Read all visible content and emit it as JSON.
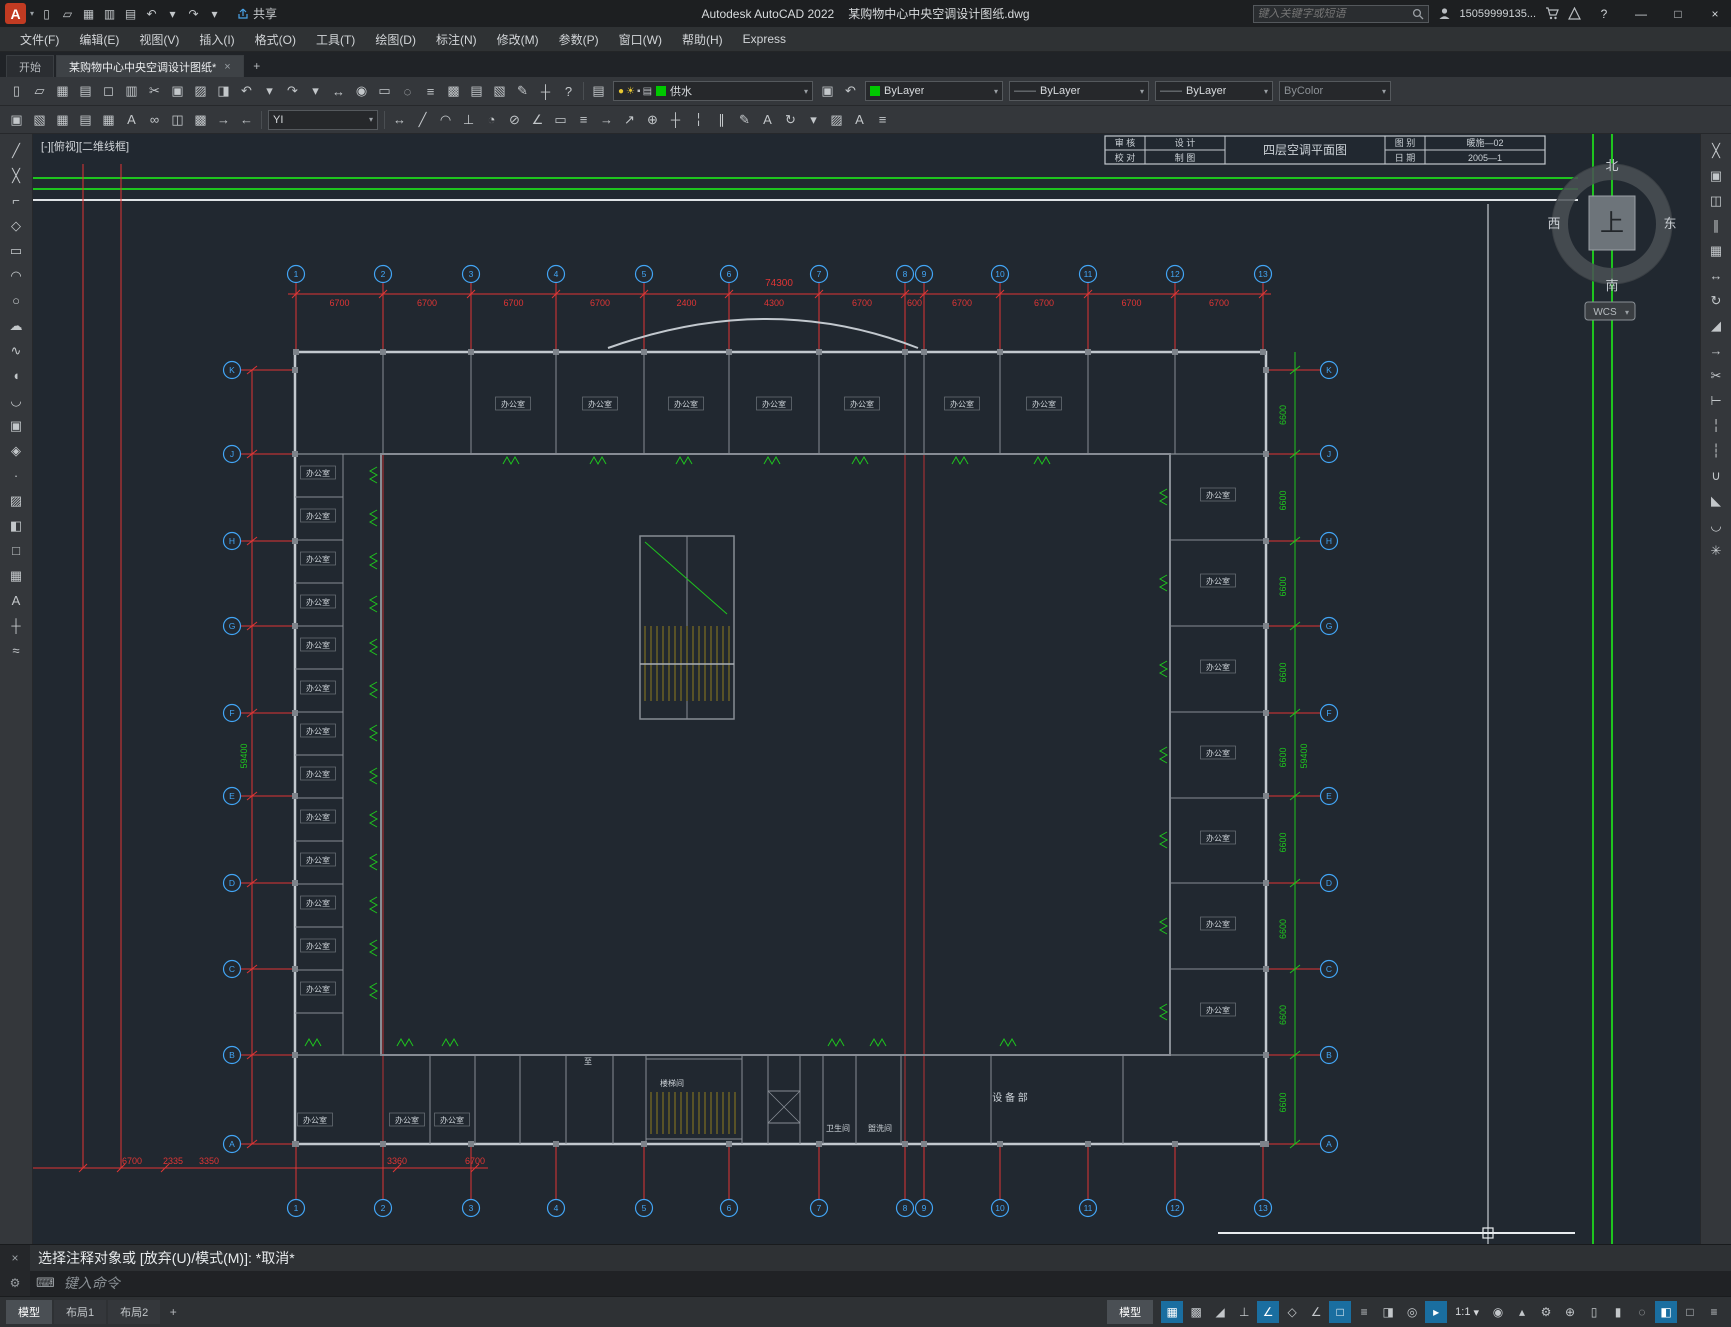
{
  "title_bar": {
    "app_title": "Autodesk AutoCAD 2022",
    "doc_title": "某购物中心中央空调设计图纸.dwg",
    "share_label": "共享",
    "search_placeholder": "键入关键字或短语",
    "user_id": "15059999135...",
    "help_glyph": "?",
    "window": {
      "minimize": "—",
      "maximize": "□",
      "close": "×"
    },
    "qat_icons": [
      {
        "name": "new-file-icon",
        "glyph": "▯"
      },
      {
        "name": "open-file-icon",
        "glyph": "▱"
      },
      {
        "name": "save-icon",
        "glyph": "▦"
      },
      {
        "name": "save-as-icon",
        "glyph": "▥"
      },
      {
        "name": "plot-icon",
        "glyph": "▤"
      },
      {
        "name": "undo-icon",
        "glyph": "↶"
      },
      {
        "name": "undo-list-icon",
        "glyph": "▾"
      },
      {
        "name": "redo-icon",
        "glyph": "↷"
      },
      {
        "name": "redo-list-icon",
        "glyph": "▾"
      }
    ]
  },
  "menu_bar": {
    "items": [
      "文件(F)",
      "编辑(E)",
      "视图(V)",
      "插入(I)",
      "格式(O)",
      "工具(T)",
      "绘图(D)",
      "标注(N)",
      "修改(M)",
      "参数(P)",
      "窗口(W)",
      "帮助(H)",
      "Express"
    ]
  },
  "tab_bar": {
    "start_tab": "开始",
    "doc_tab": "某购物中心中央空调设计图纸*",
    "close_glyph": "×",
    "new_tab_glyph": "+"
  },
  "toolbar1": {
    "icons": [
      {
        "name": "new-file-icon",
        "glyph": "▯"
      },
      {
        "name": "open-file-icon",
        "glyph": "▱"
      },
      {
        "name": "save-icon",
        "glyph": "▦"
      },
      {
        "name": "plot-icon",
        "glyph": "▤"
      },
      {
        "name": "plot-preview-icon",
        "glyph": "◻"
      },
      {
        "name": "publish-icon",
        "glyph": "▥"
      },
      {
        "name": "cut-icon",
        "glyph": "✂"
      },
      {
        "name": "copy-clip-icon",
        "glyph": "▣"
      },
      {
        "name": "paste-icon",
        "glyph": "▨"
      },
      {
        "name": "match-properties-icon",
        "glyph": "◨"
      },
      {
        "name": "undo-icon",
        "glyph": "↶"
      },
      {
        "name": "undo-list-icon",
        "glyph": "▾"
      },
      {
        "name": "redo-icon",
        "glyph": "↷"
      },
      {
        "name": "redo-list-icon",
        "glyph": "▾"
      },
      {
        "name": "pan-icon",
        "glyph": "↔"
      },
      {
        "name": "zoom-realtime-icon",
        "glyph": "◉"
      },
      {
        "name": "zoom-window-icon",
        "glyph": "▭"
      },
      {
        "name": "zoom-previous-icon",
        "glyph": "◌"
      },
      {
        "name": "properties-palette-icon",
        "glyph": "≡"
      },
      {
        "name": "designcenter-icon",
        "glyph": "▩"
      },
      {
        "name": "tool-palettes-icon",
        "glyph": "▤"
      },
      {
        "name": "sheet-set-manager-icon",
        "glyph": "▧"
      },
      {
        "name": "markup-icon",
        "glyph": "✎"
      },
      {
        "name": "quickcalc-icon",
        "glyph": "┼"
      },
      {
        "name": "help-icon",
        "glyph": "?"
      }
    ],
    "layer_properties_icon": "▤",
    "layer_states": [
      {
        "name": "layer-on-icon",
        "glyph": "●",
        "color": "#e8c832"
      },
      {
        "name": "layer-freeze-icon",
        "glyph": "☀",
        "color": "#e8c832"
      },
      {
        "name": "layer-lock-icon",
        "glyph": "▪",
        "color": "#b9bdc1"
      },
      {
        "name": "layer-plot-icon",
        "glyph": "▤",
        "color": "#b9bdc1"
      }
    ],
    "layer_color": "#00c800",
    "layer_value": "供水",
    "make_current_icon": "▣",
    "layer_previous_icon": "↶",
    "color_swatch": "#00c800",
    "color_value": "ByLayer",
    "linetype_value": "ByLayer",
    "lineweight_value": "ByLayer",
    "plotstyle_value": "ByColor"
  },
  "toolbar2": {
    "icons_left": [
      {
        "name": "insert-block-icon",
        "glyph": "▣"
      },
      {
        "name": "attach-xref-icon",
        "glyph": "▧"
      },
      {
        "name": "attach-image-icon",
        "glyph": "▦"
      },
      {
        "name": "field-icon",
        "glyph": "▤"
      },
      {
        "name": "table-icon",
        "glyph": "▦"
      },
      {
        "name": "mtext-icon",
        "glyph": "A"
      },
      {
        "name": "hyperlink-icon",
        "glyph": "∞"
      },
      {
        "name": "ole-object-icon",
        "glyph": "◫"
      },
      {
        "name": "raster-icon",
        "glyph": "▩"
      },
      {
        "name": "import-icon",
        "glyph": "→"
      },
      {
        "name": "export-icon",
        "glyph": "←"
      }
    ],
    "text_style_value": "YI",
    "icons_right": [
      {
        "name": "linear-dimension-icon",
        "glyph": "↔"
      },
      {
        "name": "aligned-dimension-icon",
        "glyph": "╱"
      },
      {
        "name": "arc-length-icon",
        "glyph": "◠"
      },
      {
        "name": "ordinate-icon",
        "glyph": "⊥"
      },
      {
        "name": "radius-dimension-icon",
        "glyph": "◔"
      },
      {
        "name": "diameter-dimension-icon",
        "glyph": "⊘"
      },
      {
        "name": "angular-dimension-icon",
        "glyph": "∠"
      },
      {
        "name": "quick-dimension-icon",
        "glyph": "▭"
      },
      {
        "name": "baseline-dimension-icon",
        "glyph": "≡"
      },
      {
        "name": "continue-dimension-icon",
        "glyph": "→"
      },
      {
        "name": "multileader-icon",
        "glyph": "↗"
      },
      {
        "name": "tolerance-icon",
        "glyph": "⊕"
      },
      {
        "name": "center-mark-icon",
        "glyph": "┼"
      },
      {
        "name": "dimension-break-icon",
        "glyph": "╎"
      },
      {
        "name": "dimension-space-icon",
        "glyph": "∥"
      },
      {
        "name": "dimension-edit-icon",
        "glyph": "✎"
      },
      {
        "name": "dimension-text-edit-icon",
        "glyph": "A"
      },
      {
        "name": "dimension-update-icon",
        "glyph": "↻"
      },
      {
        "name": "dimension-style-icon",
        "glyph": "▾"
      },
      {
        "name": "hatch-icon",
        "glyph": "▨"
      },
      {
        "name": "text-style-icon",
        "glyph": "A"
      },
      {
        "name": "properties-icon",
        "glyph": "≡"
      }
    ]
  },
  "left_toolbar": {
    "icons": [
      {
        "name": "line-icon",
        "glyph": "╱"
      },
      {
        "name": "construction-line-icon",
        "glyph": "╳"
      },
      {
        "name": "polyline-icon",
        "glyph": "⌐"
      },
      {
        "name": "polygon-icon",
        "glyph": "◇"
      },
      {
        "name": "rectangle-icon",
        "glyph": "▭"
      },
      {
        "name": "arc-icon",
        "glyph": "◠"
      },
      {
        "name": "circle-icon",
        "glyph": "○"
      },
      {
        "name": "revision-cloud-icon",
        "glyph": "☁"
      },
      {
        "name": "spline-icon",
        "glyph": "∿"
      },
      {
        "name": "ellipse-icon",
        "glyph": "◖"
      },
      {
        "name": "ellipse-arc-icon",
        "glyph": "◡"
      },
      {
        "name": "insert-block-icon",
        "glyph": "▣"
      },
      {
        "name": "make-block-icon",
        "glyph": "◈"
      },
      {
        "name": "point-icon",
        "glyph": "·"
      },
      {
        "name": "hatch-icon",
        "glyph": "▨"
      },
      {
        "name": "gradient-icon",
        "glyph": "◧"
      },
      {
        "name": "region-icon",
        "glyph": "□"
      },
      {
        "name": "table-icon",
        "glyph": "▦"
      },
      {
        "name": "multiline-text-icon",
        "glyph": "A"
      },
      {
        "name": "dimension-icon",
        "glyph": "┼"
      },
      {
        "name": "measure-icon",
        "glyph": "≈"
      }
    ]
  },
  "right_toolbar": {
    "icons": [
      {
        "name": "erase-icon",
        "glyph": "╳"
      },
      {
        "name": "copy-icon",
        "glyph": "▣"
      },
      {
        "name": "mirror-icon",
        "glyph": "◫"
      },
      {
        "name": "offset-icon",
        "glyph": "∥"
      },
      {
        "name": "array-icon",
        "glyph": "▦"
      },
      {
        "name": "move-icon",
        "glyph": "↔"
      },
      {
        "name": "rotate-icon",
        "glyph": "↻"
      },
      {
        "name": "scale-icon",
        "glyph": "◢"
      },
      {
        "name": "stretch-icon",
        "glyph": "→"
      },
      {
        "name": "trim-icon",
        "glyph": "✂"
      },
      {
        "name": "extend-icon",
        "glyph": "⊢"
      },
      {
        "name": "break-at-point-icon",
        "glyph": "╎"
      },
      {
        "name": "break-icon",
        "glyph": "┆"
      },
      {
        "name": "join-icon",
        "glyph": "∪"
      },
      {
        "name": "chamfer-icon",
        "glyph": "◣"
      },
      {
        "name": "fillet-icon",
        "glyph": "◡"
      },
      {
        "name": "explode-icon",
        "glyph": "✳"
      }
    ]
  },
  "canvas": {
    "viewport_label": "[-][俯视][二维线框]",
    "wcs_label": "WCS",
    "compass": {
      "north": "北",
      "south": "南",
      "west": "西",
      "east": "东",
      "center": "上"
    },
    "title_block": {
      "c1": "审 核",
      "c2": "校 对",
      "c3": "设 计",
      "c4": "制 图",
      "name": "四层空调平面图",
      "r1_label": "图 别",
      "r1_value": "暖施—02",
      "r2_label": "日 期",
      "r2_value": "2005—1"
    },
    "grid_cols": [
      "1",
      "2",
      "3",
      "4",
      "5",
      "6",
      "7",
      "8",
      "9",
      "10",
      "11",
      "12",
      "13"
    ],
    "grid_rows": [
      "K",
      "J",
      "H",
      "G",
      "F",
      "E",
      "D",
      "C",
      "B",
      "A"
    ],
    "total_width_dim": "74300",
    "top_dims": [
      "6700",
      "6700",
      "6700",
      "6700",
      "2400",
      "4300",
      "6700",
      "600",
      "6700",
      "6700",
      "6700",
      "6700"
    ],
    "bottom_left_dims": [
      "6700",
      "2335",
      "3350"
    ],
    "bottom_dims": [
      "3360",
      "6700"
    ],
    "side_dim_total": "59400",
    "right_dims": [
      "6600",
      "6600",
      "6600",
      "6600",
      "6600",
      "6600",
      "6600",
      "6600",
      "6600"
    ],
    "rooms_top": [
      "办公室",
      "办公室",
      "办公室",
      "办公室",
      "办公室",
      "办公室",
      "办公室"
    ],
    "rooms_left": [
      "办公室",
      "办公室",
      "办公室",
      "办公室",
      "办公室",
      "办公室",
      "办公室",
      "办公室",
      "办公室",
      "办公室",
      "办公室",
      "办公室",
      "办公室"
    ],
    "rooms_right": [
      "办公室",
      "办公室",
      "办公室",
      "办公室",
      "办公室",
      "办公室",
      "办公室"
    ],
    "rooms_bottom": [
      "办公室",
      "办公室",
      "办公室"
    ],
    "special_labels": [
      "至",
      "楼梯间",
      "卫生间",
      "盥洗间",
      "设 备 部"
    ]
  },
  "command_line": {
    "history": "选择注释对象或 [放弃(U)/模式(M)]: *取消*",
    "prompt": "键入命令",
    "close_glyph": "×",
    "wrench_glyph": "⚙",
    "input_glyph": "⌨"
  },
  "status_bar": {
    "layout_tabs": [
      "模型",
      "布局1",
      "布局2"
    ],
    "new_layout_glyph": "+",
    "model_label": "模型",
    "annotation_scale": "1:1",
    "icons_left": [
      {
        "name": "grid-display-icon",
        "glyph": "▦",
        "active": true
      },
      {
        "name": "snap-mode-icon",
        "glyph": "▩",
        "active": false
      },
      {
        "name": "infer-constraints-icon",
        "glyph": "◢",
        "active": false
      },
      {
        "name": "ortho-mode-icon",
        "glyph": "⊥",
        "active": false
      },
      {
        "name": "polar-tracking-icon",
        "glyph": "∠",
        "active": true
      },
      {
        "name": "isodraft-icon",
        "glyph": "◇",
        "active": false
      },
      {
        "name": "object-snap-tracking-icon",
        "glyph": "∠",
        "active": false
      },
      {
        "name": "object-snap-icon",
        "glyph": "□",
        "active": true
      },
      {
        "name": "lineweight-display-icon",
        "glyph": "≡",
        "active": false
      },
      {
        "name": "transparency-icon",
        "glyph": "◨",
        "active": false
      },
      {
        "name": "selection-cycling-icon",
        "glyph": "◎",
        "active": false
      },
      {
        "name": "dynamic-input-icon",
        "glyph": "▸",
        "active": true
      }
    ],
    "icons_right": [
      {
        "name": "annotation-visibility-icon",
        "glyph": "◉",
        "active": false
      },
      {
        "name": "autoscale-icon",
        "glyph": "▴",
        "active": false
      },
      {
        "name": "workspace-switching-icon",
        "glyph": "⚙",
        "active": false
      },
      {
        "name": "annotation-monitor-icon",
        "glyph": "⊕",
        "active": false
      },
      {
        "name": "quick-properties-icon",
        "glyph": "▯",
        "active": false
      },
      {
        "name": "lock-ui-icon",
        "glyph": "▮",
        "active": false
      },
      {
        "name": "isolate-objects-icon",
        "glyph": "◌",
        "active": false
      },
      {
        "name": "graphics-performance-icon",
        "glyph": "◧",
        "active": true
      },
      {
        "name": "clean-screen-icon",
        "glyph": "□",
        "active": false
      },
      {
        "name": "customization-icon",
        "glyph": "≡",
        "active": false
      }
    ]
  }
}
